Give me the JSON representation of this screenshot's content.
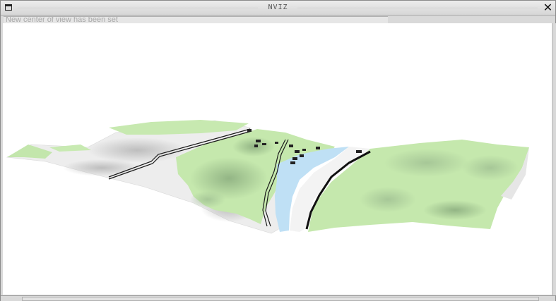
{
  "window": {
    "title": "NVIZ"
  },
  "status": {
    "message": "New center of view has been set"
  },
  "icons": {
    "menu": "window-menu-icon",
    "close": "close-icon"
  },
  "colors": {
    "grass": "#c5e8ad",
    "grass_shadow": "#93b887",
    "bare_ground": "#ececec",
    "water": "#bfe0f5",
    "road": "#1a1a1a",
    "canvas_bg": "#ffffff"
  }
}
